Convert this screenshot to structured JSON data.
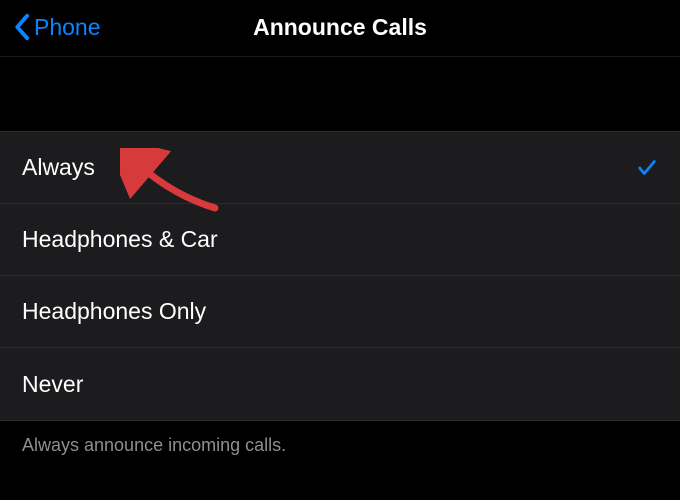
{
  "nav": {
    "back_label": "Phone",
    "title": "Announce Calls"
  },
  "options": {
    "0": {
      "label": "Always",
      "selected": true
    },
    "1": {
      "label": "Headphones & Car",
      "selected": false
    },
    "2": {
      "label": "Headphones Only",
      "selected": false
    },
    "3": {
      "label": "Never",
      "selected": false
    }
  },
  "footer": {
    "description": "Always announce incoming calls."
  },
  "colors": {
    "accent": "#0a84ff",
    "annotation": "#d63a3a"
  }
}
